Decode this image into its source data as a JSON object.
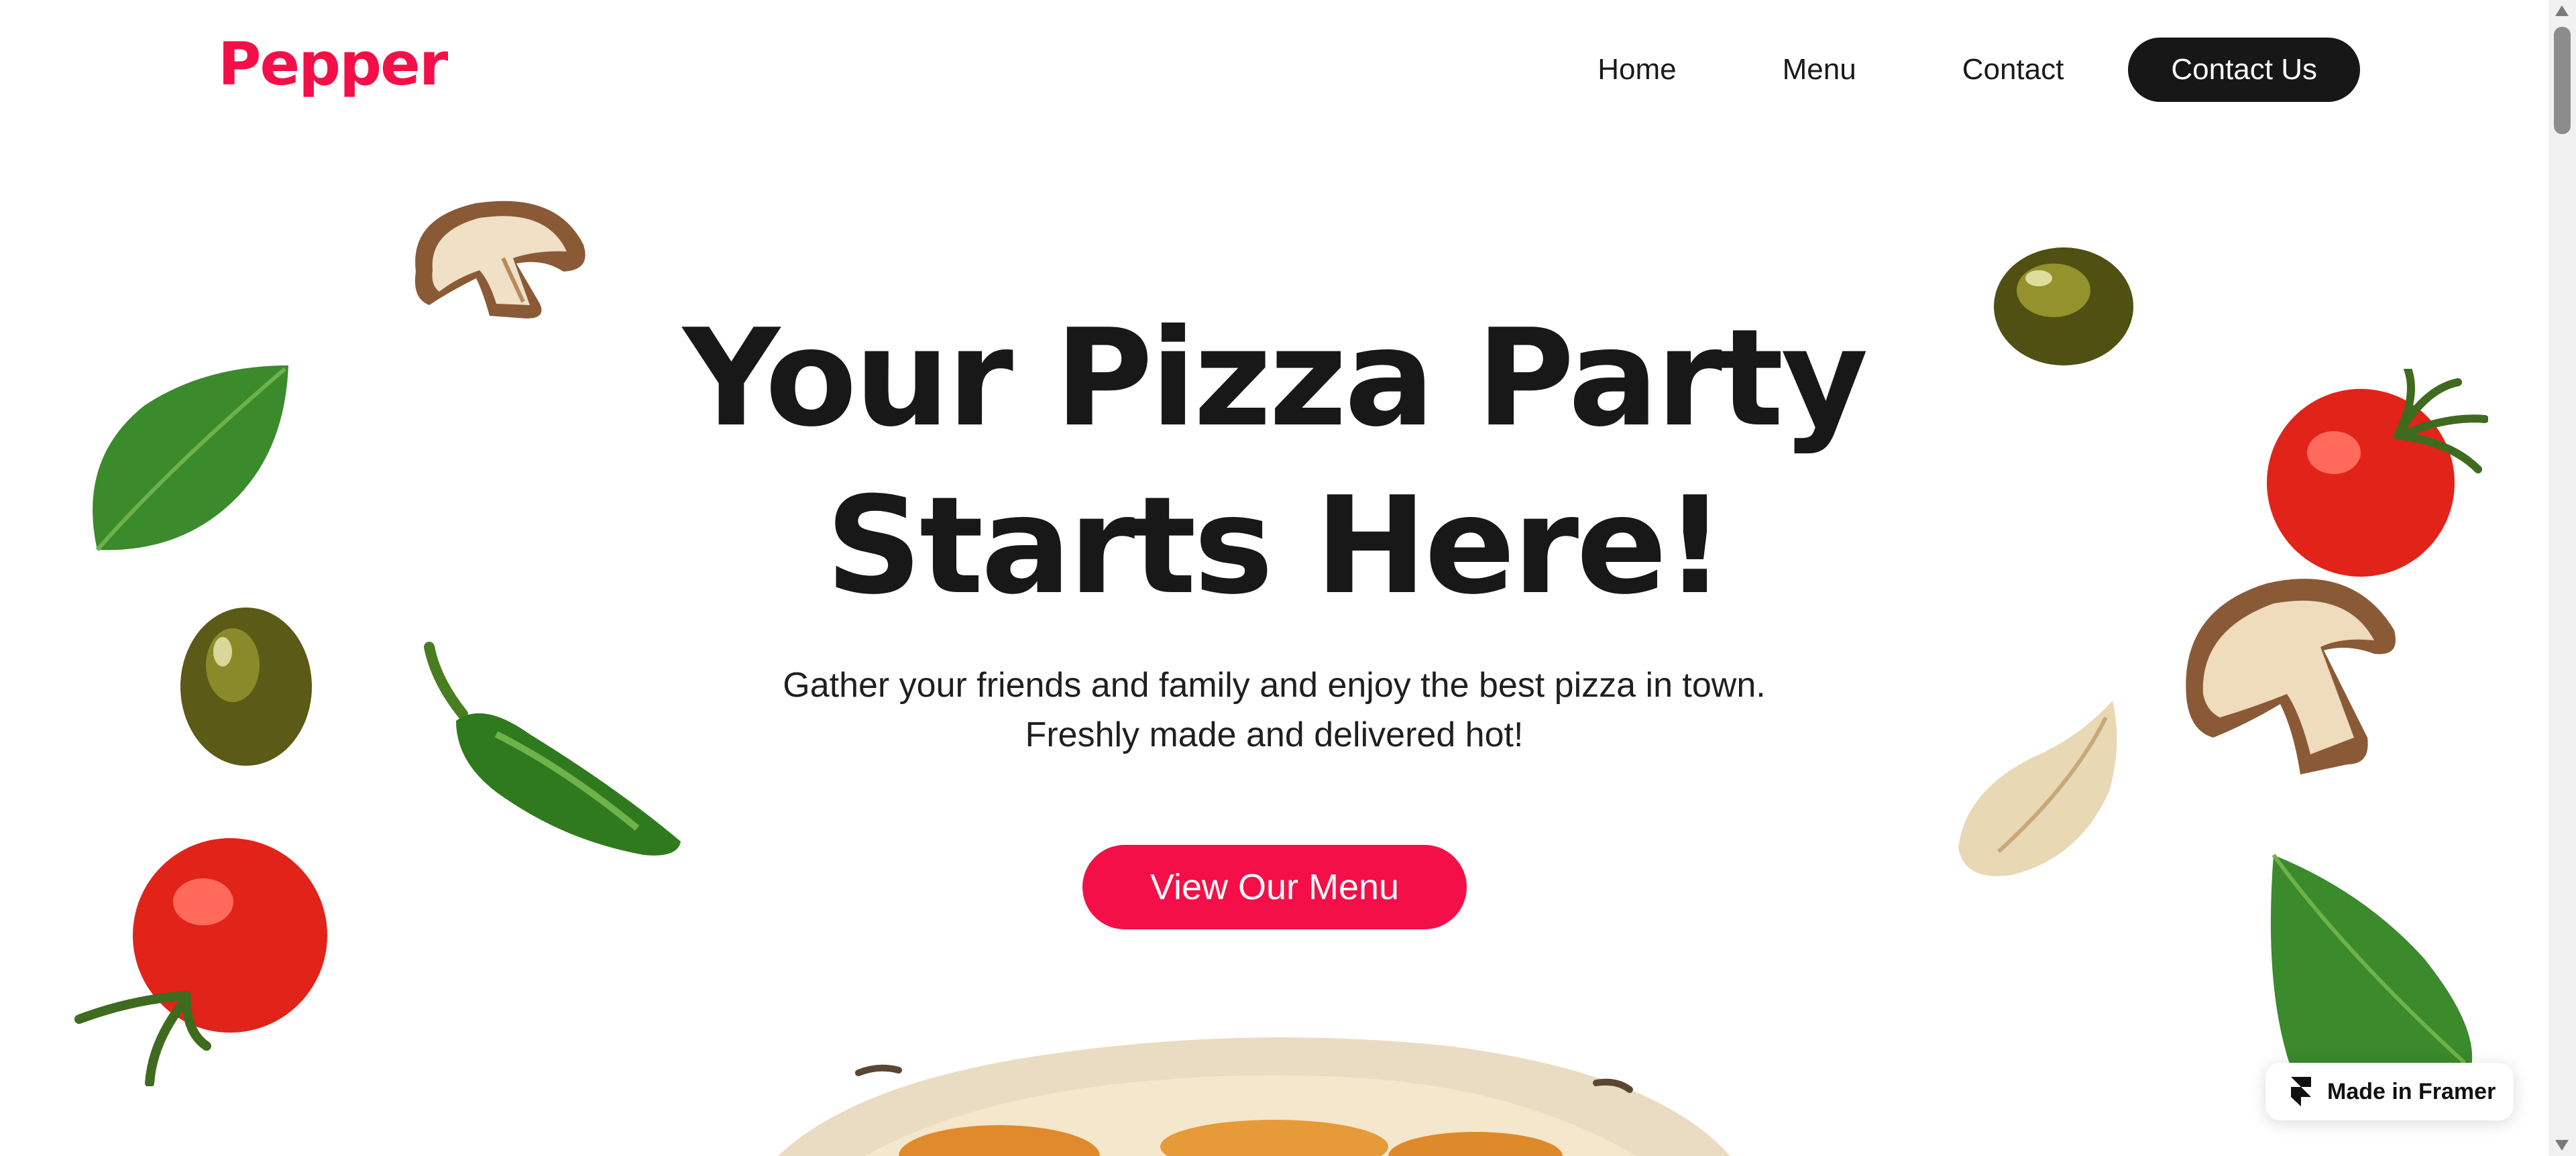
{
  "brand": {
    "name": "Pepper",
    "color": "#f40f48"
  },
  "nav": {
    "items": [
      "Home",
      "Menu",
      "Contact"
    ],
    "cta": "Contact Us"
  },
  "hero": {
    "title_line1": "Your Pizza Party",
    "title_line2": "Starts Here!",
    "subtitle_line1": "Gather your friends and family and enjoy the best pizza in town.",
    "subtitle_line2": "Freshly made and delivered hot!",
    "cta": "View Our Menu"
  },
  "badge": {
    "label": "Made in Framer"
  },
  "decorations": [
    "mushroom-image",
    "basil-leaf-image",
    "olive-image",
    "jalapeno-image",
    "tomato-image",
    "garlic-clove-image",
    "pizza-image"
  ],
  "colors": {
    "accent": "#f40f48",
    "dark": "#171717",
    "background": "#ffffff"
  }
}
